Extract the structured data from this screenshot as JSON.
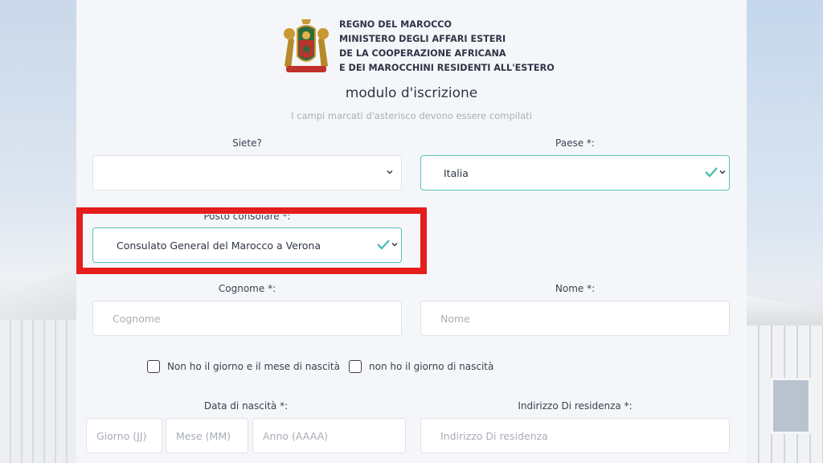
{
  "header": {
    "ministry_lines": [
      "REGNO DEL MAROCCO",
      "MINISTERO DEGLI AFFARI ESTERI",
      "DE LA COOPERAZIONE AFRICANA",
      "E DEI MAROCCHINI RESIDENTI ALL'ESTERO"
    ],
    "emblem_icon": "moroccan-coat-of-arms"
  },
  "form": {
    "title": "modulo d'iscrizione",
    "subtitle": "I campi marcati d'asterisco devono essere compilati",
    "siete": {
      "label": "Siete?",
      "value": ""
    },
    "paese": {
      "label": "Paese *:",
      "value": "Italia"
    },
    "posto_consolare": {
      "label": "Posto consolare *:",
      "value": "Consulato General del Marocco a Verona"
    },
    "cognome": {
      "label": "Cognome *:",
      "placeholder": "Cognome"
    },
    "nome": {
      "label": "Nome *:",
      "placeholder": "Nome"
    },
    "checkbox_no_day_month": {
      "label": "Non ho il giorno e il mese di nascità",
      "checked": false
    },
    "checkbox_no_day": {
      "label": "non ho il giorno di nascità",
      "checked": false
    },
    "data_nascita": {
      "label": "Data di nascità *:",
      "giorno_placeholder": "Giorno (JJ)",
      "mese_placeholder": "Mese (MM)",
      "anno_placeholder": "Anno (AAAA)"
    },
    "indirizzo": {
      "label": "Indirizzo Di residenza *:",
      "placeholder": "Indirizzo Di residenza"
    }
  },
  "colors": {
    "valid_border": "#5bc2b6",
    "highlight": "#e41d1d",
    "panel": "#f4f6f9"
  }
}
